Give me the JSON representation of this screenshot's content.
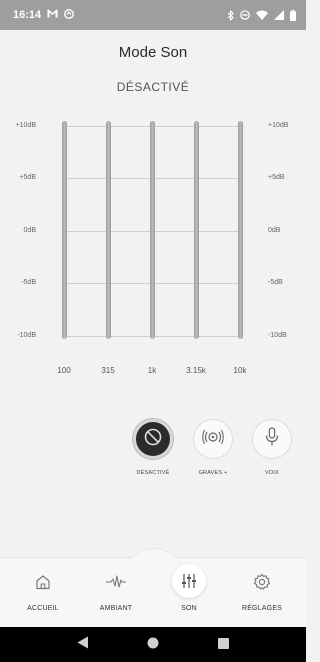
{
  "status_bar": {
    "time": "16:14",
    "icons_left": [
      "gmail-icon",
      "app-notification-icon"
    ],
    "icons_right": [
      "bluetooth-icon",
      "do-not-disturb-icon",
      "wifi-icon",
      "signal-icon",
      "battery-icon"
    ]
  },
  "header": {
    "title": "Mode Son",
    "state": "DÉSACTIVÉ"
  },
  "equalizer": {
    "db_levels": [
      "+10dB",
      "+5dB",
      "0dB",
      "-5dB",
      "-10dB"
    ],
    "bands": [
      {
        "freq": "100",
        "gain_db": 0
      },
      {
        "freq": "315",
        "gain_db": 0
      },
      {
        "freq": "1k",
        "gain_db": 0
      },
      {
        "freq": "3.15k",
        "gain_db": 0
      },
      {
        "freq": "10k",
        "gain_db": 0
      }
    ]
  },
  "sound_modes": [
    {
      "label": "DÉSACTIVÉ",
      "icon": "disabled-icon",
      "active": true
    },
    {
      "label": "GRAVES +",
      "icon": "bass-boost-icon",
      "active": false
    },
    {
      "label": "VOIX",
      "icon": "microphone-icon",
      "active": false
    }
  ],
  "bottom_nav": [
    {
      "label": "ACCUEIL",
      "icon": "home-icon",
      "active": false
    },
    {
      "label": "AMBIANT",
      "icon": "ambient-wave-icon",
      "active": false
    },
    {
      "label": "SON",
      "icon": "equalizer-sliders-icon",
      "active": true
    },
    {
      "label": "RÉGLAGES",
      "icon": "gear-icon",
      "active": false
    }
  ],
  "colors": {
    "status_bar": "#9e9e9e",
    "background": "#f2f2f2",
    "active_mode": "#2b2b2b",
    "system_nav": "#000000"
  }
}
